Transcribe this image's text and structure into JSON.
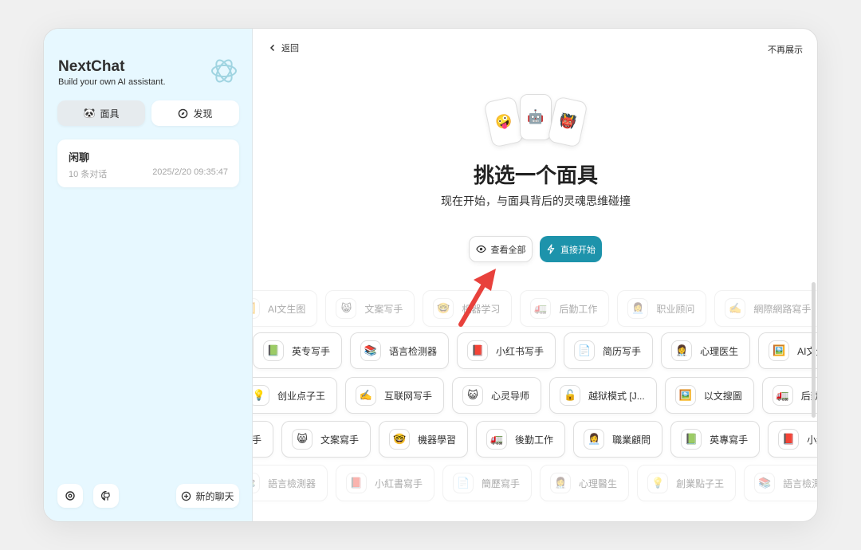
{
  "sidebar": {
    "title": "NextChat",
    "subtitle": "Build your own AI assistant.",
    "tabs": [
      {
        "label": "面具",
        "icon": "mask-icon"
      },
      {
        "label": "发现",
        "icon": "compass-icon"
      }
    ],
    "chats": [
      {
        "title": "闲聊",
        "count": "10 条对话",
        "time": "2025/2/20 09:35:47"
      }
    ],
    "footer": {
      "new_chat_label": "新的聊天"
    }
  },
  "main": {
    "back_label": "返回",
    "no_show_label": "不再展示",
    "title": "挑选一个面具",
    "subtitle": "现在开始，与面具背后的灵魂思维碰撞",
    "view_all_label": "查看全部",
    "start_label": "直接开始",
    "card_emojis": [
      "🤪",
      "🤖",
      "👹"
    ],
    "mask_rows": [
      {
        "faded": true,
        "items": [
          {
            "icon": "🖼️",
            "label": "AI文生图"
          },
          {
            "icon": "😸",
            "label": "文案写手"
          },
          {
            "icon": "🤓",
            "label": "机器学习"
          },
          {
            "icon": "🚛",
            "label": "后勤工作"
          },
          {
            "icon": "👩‍💼",
            "label": "职业顾问"
          },
          {
            "icon": "✍️",
            "label": "網際網路寫手"
          }
        ]
      },
      {
        "faded": false,
        "items": [
          {
            "icon": "📗",
            "label": "英专写手"
          },
          {
            "icon": "📚",
            "label": "语言检测器"
          },
          {
            "icon": "📕",
            "label": "小红书写手"
          },
          {
            "icon": "📄",
            "label": "简历写手"
          },
          {
            "icon": "👩‍⚕️",
            "label": "心理医生"
          },
          {
            "icon": "🖼️",
            "label": "AI文生图"
          }
        ]
      },
      {
        "faded": false,
        "items": [
          {
            "icon": "💡",
            "label": "创业点子王"
          },
          {
            "icon": "✍️",
            "label": "互联网写手"
          },
          {
            "icon": "😺",
            "label": "心灵导师"
          },
          {
            "icon": "🔓",
            "label": "越狱模式 [J..."
          },
          {
            "icon": "🖼️",
            "label": "以文搜圖"
          },
          {
            "icon": "🚛",
            "label": "后勤工作"
          }
        ]
      },
      {
        "faded": false,
        "items": [
          {
            "icon": "✍️",
            "label": "網際網路寫手"
          },
          {
            "icon": "😸",
            "label": "文案寫手"
          },
          {
            "icon": "🤓",
            "label": "機器學習"
          },
          {
            "icon": "🚛",
            "label": "後勤工作"
          },
          {
            "icon": "👩‍💼",
            "label": "職業顧問"
          },
          {
            "icon": "📗",
            "label": "英專寫手"
          },
          {
            "icon": "📕",
            "label": "小红書寫手"
          }
        ]
      },
      {
        "faded": true,
        "items": [
          {
            "icon": "📚",
            "label": "語言檢測器"
          },
          {
            "icon": "📕",
            "label": "小紅書寫手"
          },
          {
            "icon": "📄",
            "label": "簡歷寫手"
          },
          {
            "icon": "👩‍⚕️",
            "label": "心理醫生"
          },
          {
            "icon": "💡",
            "label": "創業點子王"
          },
          {
            "icon": "📚",
            "label": "語言檢測器"
          }
        ]
      }
    ]
  },
  "colors": {
    "sidebar_bg": "#e7f8ff",
    "accent": "#1d93ab",
    "annotation_arrow": "#e8413c"
  }
}
